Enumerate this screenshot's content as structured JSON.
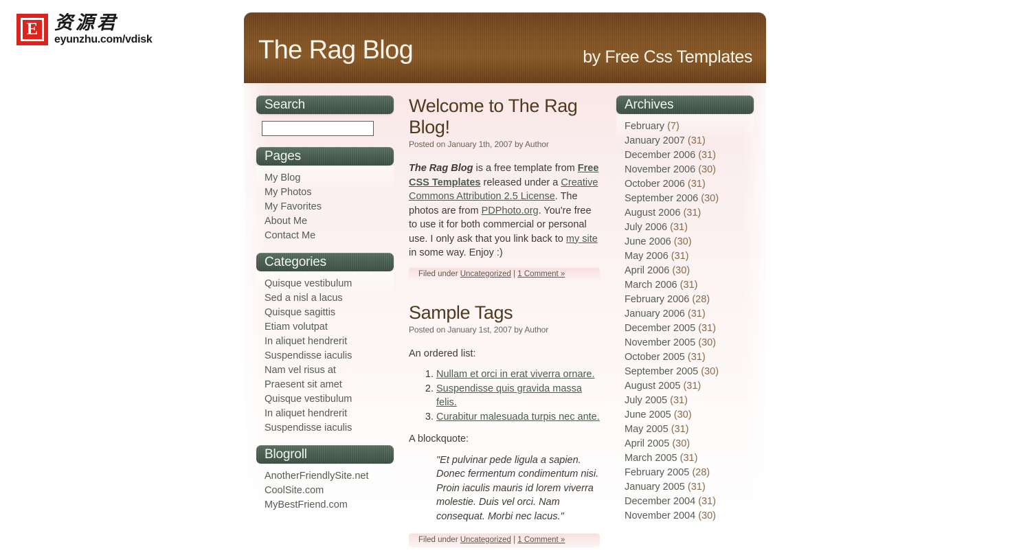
{
  "watermark": {
    "badge_letter": "E",
    "chinese_text": "资源君",
    "url_text": "eyunzhu.com/vdisk"
  },
  "header": {
    "title": "The Rag Blog",
    "tagline": "by Free Css Templates"
  },
  "sidebar_left": {
    "search": {
      "title": "Search",
      "value": "",
      "placeholder": ""
    },
    "pages": {
      "title": "Pages",
      "items": [
        "My Blog",
        "My Photos",
        "My Favorites",
        "About Me",
        "Contact Me"
      ]
    },
    "categories": {
      "title": "Categories",
      "items": [
        "Quisque vestibulum",
        "Sed a nisl a lacus",
        "Quisque sagittis",
        "Etiam volutpat",
        "In aliquet hendrerit",
        "Suspendisse iaculis",
        "Nam vel risus at",
        "Praesent sit amet",
        "Quisque vestibulum",
        "In aliquet hendrerit",
        "Suspendisse iaculis"
      ]
    },
    "blogroll": {
      "title": "Blogroll",
      "items": [
        "AnotherFriendlySite.net",
        "CoolSite.com",
        "MyBestFriend.com"
      ]
    }
  },
  "sidebar_right": {
    "archives": {
      "title": "Archives",
      "items": [
        {
          "label": "February",
          "count": "(7)"
        },
        {
          "label": "January 2007",
          "count": "(31)"
        },
        {
          "label": "December 2006",
          "count": "(31)"
        },
        {
          "label": "November 2006",
          "count": "(30)"
        },
        {
          "label": "October 2006",
          "count": "(31)"
        },
        {
          "label": "September 2006",
          "count": "(30)"
        },
        {
          "label": "August 2006",
          "count": "(31)"
        },
        {
          "label": "July 2006",
          "count": "(31)"
        },
        {
          "label": "June 2006",
          "count": "(30)"
        },
        {
          "label": "May 2006",
          "count": "(31)"
        },
        {
          "label": "April 2006",
          "count": "(30)"
        },
        {
          "label": "March 2006",
          "count": "(31)"
        },
        {
          "label": "February 2006",
          "count": "(28)"
        },
        {
          "label": "January 2006",
          "count": "(31)"
        },
        {
          "label": "December 2005",
          "count": "(31)"
        },
        {
          "label": "November 2005",
          "count": "(30)"
        },
        {
          "label": "October 2005",
          "count": "(31)"
        },
        {
          "label": "September 2005",
          "count": "(30)"
        },
        {
          "label": "August 2005",
          "count": "(31)"
        },
        {
          "label": "July 2005",
          "count": "(31)"
        },
        {
          "label": "June 2005",
          "count": "(30)"
        },
        {
          "label": "May 2005",
          "count": "(31)"
        },
        {
          "label": "April 2005",
          "count": "(30)"
        },
        {
          "label": "March 2005",
          "count": "(31)"
        },
        {
          "label": "February 2005",
          "count": "(28)"
        },
        {
          "label": "January 2005",
          "count": "(31)"
        },
        {
          "label": "December 2004",
          "count": "(31)"
        },
        {
          "label": "November 2004",
          "count": "(30)"
        }
      ]
    }
  },
  "posts": {
    "welcome": {
      "title": "Welcome to The Rag Blog!",
      "date": "Posted on January 1th, 2007 by Author",
      "body": {
        "lead_name": "The Rag Blog",
        "t1": " is a free template from ",
        "link_fct": "Free CSS Templates",
        "t2": " released under a ",
        "link_cc": "Creative Commons Attribution 2.5 License",
        "t3": ". The photos are from ",
        "link_pd": "PDPhoto.org",
        "t4": ". You're free to use it for both commercial or personal use. I only ask that you link back to ",
        "link_my": "my site",
        "t5": " in some way. Enjoy :)"
      },
      "meta": {
        "filed_label": "Filed under ",
        "category": "Uncategorized",
        "separator": " | ",
        "comments": "1 Comment »"
      }
    },
    "tags": {
      "title": "Sample Tags",
      "date": "Posted on January 1st, 2007 by Author",
      "list_intro": "An ordered list:",
      "list_items": [
        "Nullam et orci in erat viverra ornare.",
        "Suspendisse quis gravida massa felis.",
        "Curabitur malesuada turpis nec ante."
      ],
      "quote_intro": "A blockquote:",
      "quote": "\"Et pulvinar pede ligula a sapien. Donec fermentum condimentum nisi. Proin iaculis mauris id lorem viverra molestie. Duis vel orci. Nam consequat. Morbi nec lacus.\"",
      "meta": {
        "filed_label": "Filed under ",
        "category": "Uncategorized",
        "separator": " | ",
        "comments": "1 Comment »"
      }
    }
  },
  "colors": {
    "header_brown": "#7d4f22",
    "widget_green": "#4c6253",
    "title_brown": "#50391f",
    "meta_pink": "#f7dede",
    "accent_red": "#d9251d"
  }
}
